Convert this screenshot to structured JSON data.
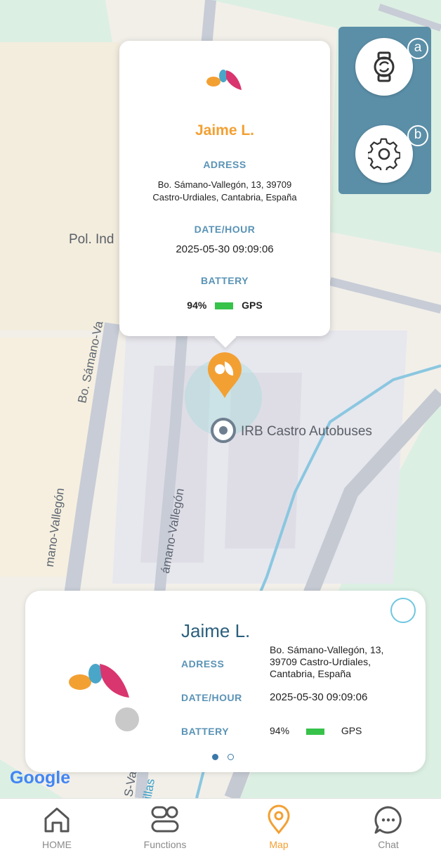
{
  "map": {
    "poi_pol": "Pol. Ind",
    "poi_bus": "IRB Castro Autobuses",
    "street_1": "Bo. Sámano-Va",
    "street_2": "mano-Vallegón",
    "street_3": "ámano-Vallegón",
    "street_4": "S-Va",
    "street_5": "illas",
    "google_label": "Google",
    "colors": {
      "marker": "#f3a033",
      "accent": "#5a93b6",
      "panel": "#5b8fa8"
    }
  },
  "popup": {
    "name": "Jaime L.",
    "address_label": "ADRESS",
    "address_line1": "Bo. Sámano-Vallegón, 13, 39709",
    "address_line2": "Castro-Urdiales, Cantabria, España",
    "date_label": "DATE/HOUR",
    "date_value": "2025-05-30 09:09:06",
    "battery_label": "BATTERY",
    "battery_value": "94%",
    "gps_label": "GPS"
  },
  "side_panel": {
    "badge_a": "a",
    "badge_b": "b"
  },
  "card": {
    "name": "Jaime L.",
    "address_label": "ADRESS",
    "address_line1": "Bo. Sámano-Vallegón, 13,",
    "address_line2": "39709 Castro-Urdiales,",
    "address_line3": "Cantabria, España",
    "date_label": "DATE/HOUR",
    "date_value": "2025-05-30 09:09:06",
    "battery_label": "BATTERY",
    "battery_value": "94%",
    "gps_label": "GPS",
    "page_count": 2,
    "active_page": 1
  },
  "nav": {
    "home": "HOME",
    "functions": "Functions",
    "map": "Map",
    "chat": "Chat"
  }
}
